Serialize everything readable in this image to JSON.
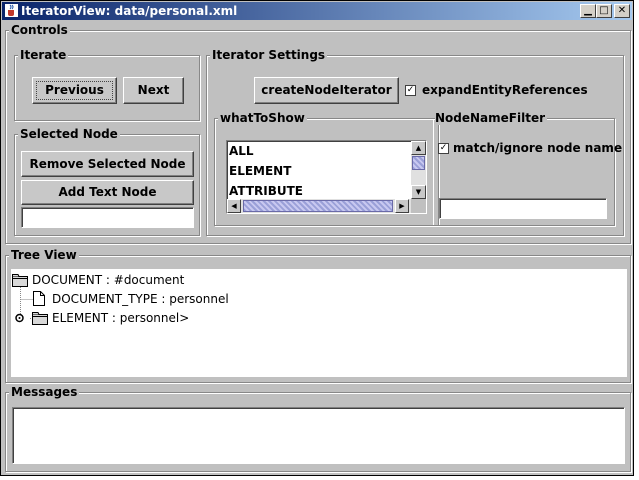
{
  "window": {
    "title": "IteratorView: data/personal.xml"
  },
  "controls": {
    "label": "Controls",
    "iterate": {
      "label": "Iterate",
      "previous": "Previous",
      "next": "Next"
    },
    "selected_node": {
      "label": "Selected Node",
      "remove": "Remove Selected Node",
      "add_text": "Add Text Node",
      "text_value": ""
    },
    "settings": {
      "label": "Iterator Settings",
      "create_button": "createNodeIterator",
      "expand_label": "expandEntityReferences",
      "expand_checked": true,
      "what_to_show": {
        "label": "whatToShow",
        "items": [
          "ALL",
          "ELEMENT",
          "ATTRIBUTE"
        ]
      },
      "filter": {
        "label": "NodeNameFilter",
        "match_label": "match/ignore node name",
        "match_checked": true,
        "value": ""
      }
    }
  },
  "tree": {
    "label": "Tree View",
    "nodes": [
      {
        "text": "DOCUMENT : #document"
      },
      {
        "text": "DOCUMENT_TYPE : personnel"
      },
      {
        "text": "ELEMENT : personnel>"
      }
    ]
  },
  "messages": {
    "label": "Messages",
    "text": ""
  }
}
